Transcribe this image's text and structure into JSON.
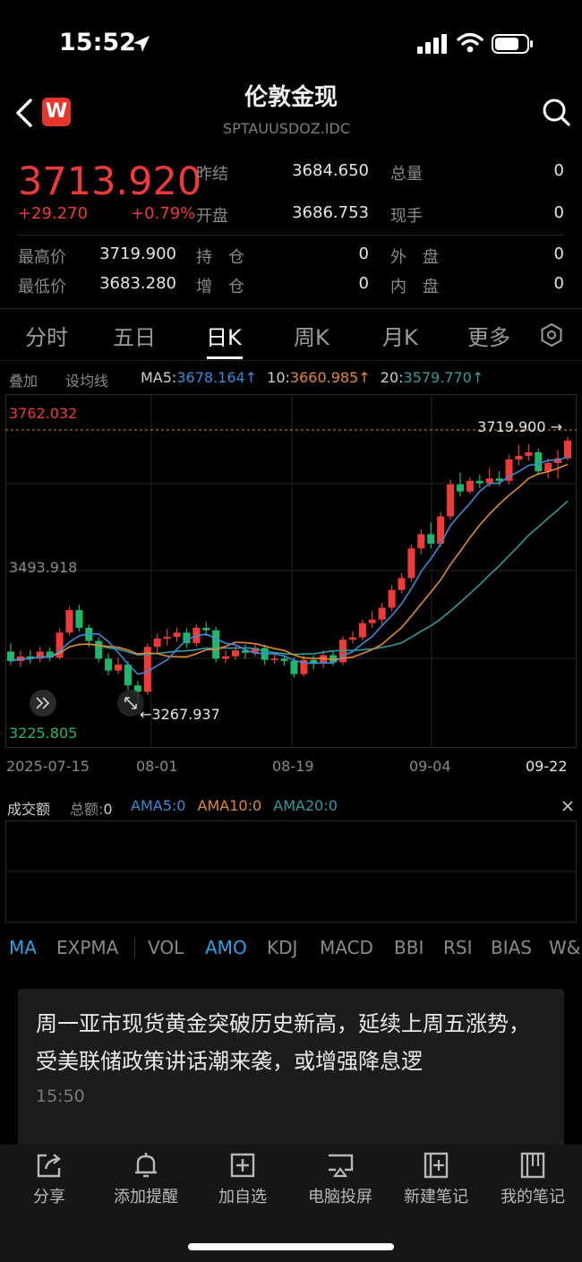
{
  "status": {
    "time": "15:52"
  },
  "header": {
    "title": "伦敦金现",
    "subtitle": "SPTAUUSDOZ.IDC",
    "logo_letter": "W"
  },
  "quote": {
    "price": "3713.920",
    "change": "+29.270",
    "change_pct": "+0.79%",
    "prev_close_label": "昨结",
    "prev_close": "3684.650",
    "open_label": "开盘",
    "open": "3686.753",
    "total_vol_label": "总量",
    "total_vol": "0",
    "cur_hand_label": "现手",
    "cur_hand": "0",
    "high_label": "最高价",
    "high": "3719.900",
    "low_label": "最低价",
    "low": "3683.280",
    "hold_label": "持　仓",
    "hold": "0",
    "add_label": "增　仓",
    "add": "0",
    "outer_label": "外　盘",
    "outer": "0",
    "inner_label": "内　盘",
    "inner": "0"
  },
  "tabs": [
    "分时",
    "五日",
    "日K",
    "周K",
    "月K",
    "更多"
  ],
  "ma_bar": {
    "overlay": "叠加",
    "set_ma": "设均线",
    "ma5_label": "MA5:",
    "ma5": "3678.164↑",
    "ma10_label": "10:",
    "ma10": "3660.985↑",
    "ma20_label": "20:",
    "ma20": "3579.770↑"
  },
  "colors": {
    "up": "#f03a3a",
    "down": "#1fb86a",
    "ma5": "#3b8bd9",
    "ma10": "#e48a2e",
    "ma20": "#2f9c9e"
  },
  "chart_data": {
    "type": "candlestick",
    "y_max_label": "3762.032",
    "y_mid_label": "3493.918",
    "y_min_label": "3225.805",
    "ylim": [
      3225.805,
      3762.032
    ],
    "high_marker": "3719.900 →",
    "low_marker": "←3267.937",
    "x_tick_labels": [
      "2025-07-15",
      "08-01",
      "08-19",
      "09-04",
      "09-22"
    ],
    "candles": [
      [
        3358,
        3342,
        3372,
        3335
      ],
      [
        3342,
        3350,
        3360,
        3332
      ],
      [
        3350,
        3346,
        3360,
        3338
      ],
      [
        3346,
        3358,
        3366,
        3340
      ],
      [
        3358,
        3348,
        3365,
        3342
      ],
      [
        3348,
        3390,
        3397,
        3345
      ],
      [
        3390,
        3428,
        3434,
        3385
      ],
      [
        3428,
        3398,
        3437,
        3392
      ],
      [
        3398,
        3376,
        3404,
        3366
      ],
      [
        3376,
        3346,
        3382,
        3340
      ],
      [
        3346,
        3326,
        3355,
        3318
      ],
      [
        3326,
        3336,
        3348,
        3320
      ],
      [
        3336,
        3301,
        3341,
        3293
      ],
      [
        3301,
        3290,
        3308,
        3268
      ],
      [
        3290,
        3366,
        3372,
        3285
      ],
      [
        3366,
        3380,
        3388,
        3356
      ],
      [
        3380,
        3383,
        3396,
        3368
      ],
      [
        3383,
        3390,
        3398,
        3374
      ],
      [
        3390,
        3372,
        3397,
        3364
      ],
      [
        3372,
        3398,
        3404,
        3366
      ],
      [
        3398,
        3394,
        3408,
        3384
      ],
      [
        3394,
        3346,
        3400,
        3340
      ],
      [
        3346,
        3350,
        3360,
        3338
      ],
      [
        3350,
        3360,
        3368,
        3344
      ],
      [
        3360,
        3356,
        3370,
        3346
      ],
      [
        3356,
        3364,
        3372,
        3350
      ],
      [
        3364,
        3344,
        3370,
        3336
      ],
      [
        3344,
        3346,
        3356,
        3338
      ],
      [
        3346,
        3342,
        3352,
        3334
      ],
      [
        3342,
        3320,
        3348,
        3314
      ],
      [
        3320,
        3344,
        3352,
        3316
      ],
      [
        3344,
        3338,
        3352,
        3328
      ],
      [
        3338,
        3352,
        3360,
        3330
      ],
      [
        3352,
        3340,
        3358,
        3334
      ],
      [
        3340,
        3378,
        3384,
        3336
      ],
      [
        3378,
        3382,
        3392,
        3372
      ],
      [
        3382,
        3406,
        3412,
        3376
      ],
      [
        3406,
        3412,
        3426,
        3398
      ],
      [
        3412,
        3432,
        3440,
        3404
      ],
      [
        3432,
        3462,
        3470,
        3426
      ],
      [
        3462,
        3482,
        3490,
        3456
      ],
      [
        3482,
        3532,
        3538,
        3476
      ],
      [
        3532,
        3556,
        3564,
        3522
      ],
      [
        3556,
        3540,
        3576,
        3532
      ],
      [
        3540,
        3586,
        3594,
        3534
      ],
      [
        3586,
        3640,
        3648,
        3580
      ],
      [
        3640,
        3628,
        3660,
        3620
      ],
      [
        3628,
        3646,
        3652,
        3624
      ],
      [
        3646,
        3642,
        3656,
        3634
      ],
      [
        3642,
        3650,
        3668,
        3636
      ],
      [
        3650,
        3646,
        3662,
        3638
      ],
      [
        3646,
        3682,
        3690,
        3640
      ],
      [
        3682,
        3688,
        3706,
        3672
      ],
      [
        3688,
        3694,
        3708,
        3680
      ],
      [
        3694,
        3662,
        3700,
        3656
      ],
      [
        3662,
        3676,
        3684,
        3650
      ],
      [
        3676,
        3684,
        3698,
        3650
      ],
      [
        3684,
        3714,
        3720,
        3680
      ]
    ]
  },
  "vol": {
    "title": "成交额",
    "total_label": "总额:",
    "total": "0",
    "ama5_label": "AMA5:",
    "ama5": "0",
    "ama10_label": "AMA10:",
    "ama10": "0",
    "ama20_label": "AMA20:",
    "ama20": "0"
  },
  "indicators": [
    "MA",
    "EXPMA",
    "VOL",
    "AMO",
    "KDJ",
    "MACD",
    "BBI",
    "RSI",
    "BIAS",
    "W&"
  ],
  "news": {
    "text": "周一亚市现货黄金突破历史新高，延续上周五涨势，受美联储政策讲话潮来袭，或增强降息逻",
    "time": "15:50"
  },
  "bottom_bar": [
    "分享",
    "添加提醒",
    "加自选",
    "电脑投屏",
    "新建笔记",
    "我的笔记"
  ]
}
